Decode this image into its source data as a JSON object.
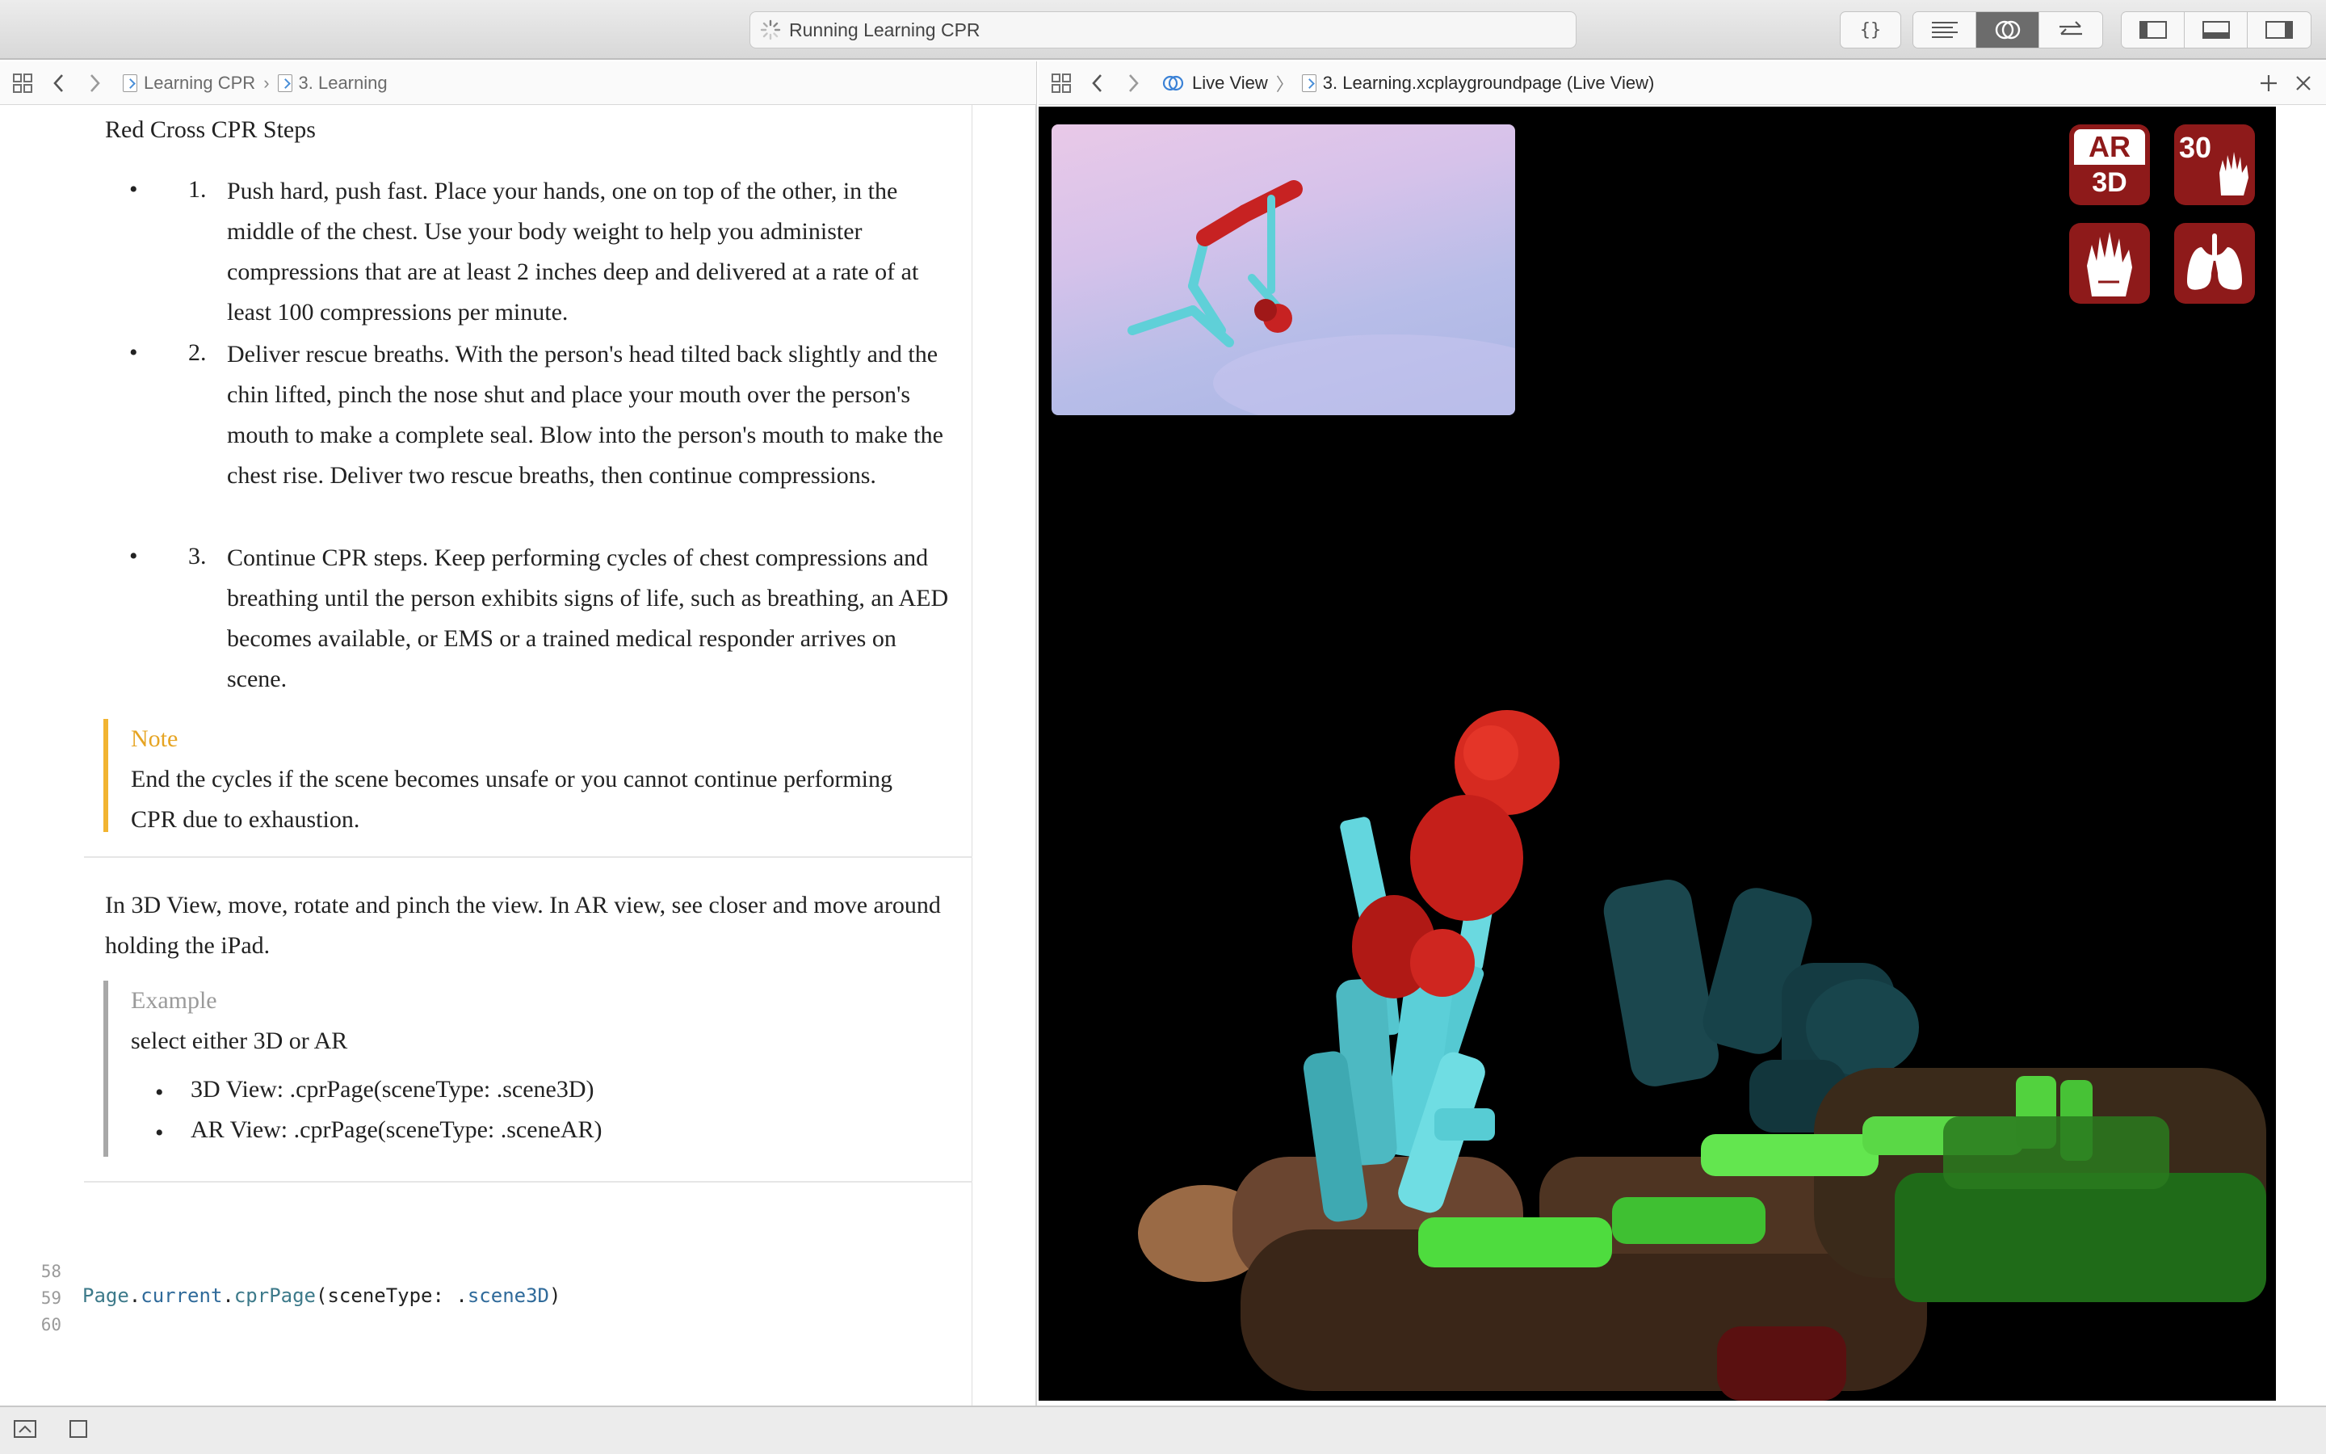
{
  "toolbar": {
    "activity_text": "Running Learning CPR"
  },
  "left_jumpbar": {
    "crumbs": [
      "Learning CPR",
      "3. Learning"
    ]
  },
  "right_jumpbar": {
    "crumbs": [
      "Live View",
      "3. Learning.xcplaygroundpage (Live View)"
    ]
  },
  "doc": {
    "heading": "Red Cross CPR Steps",
    "steps": [
      {
        "num": "1.",
        "text": "Push hard, push fast. Place your hands, one on top of the other, in the middle of the chest. Use your body weight to help you administer compressions that are at least 2 inches deep and delivered at a rate of at least 100 compressions per minute."
      },
      {
        "num": "2.",
        "text": "Deliver rescue breaths. With the person's head tilted back slightly and the chin lifted, pinch the nose shut and place your mouth over the person's mouth to make a complete seal. Blow into the person's mouth to make the chest rise. Deliver two rescue breaths, then continue compressions."
      },
      {
        "num": "3.",
        "text": "Continue CPR steps. Keep performing cycles of chest compressions and breathing until the person exhibits signs of life, such as breathing, an AED becomes available, or EMS or a trained medical responder arrives on scene."
      }
    ],
    "bullet": "•",
    "note_title": "Note",
    "note_text": "End the cycles if the scene becomes unsafe or you cannot continue performing CPR due to exhaustion.",
    "instructions": "In 3D View, move, rotate and pinch the view. In AR view, see closer and move around holding the iPad.",
    "example_title": "Example",
    "example_intro": "select either 3D or AR",
    "example_items": [
      "3D View: .cprPage(sceneType: .scene3D)",
      "AR View: .cprPage(sceneType: .sceneAR)"
    ]
  },
  "code": {
    "line_numbers": [
      "58",
      "59",
      "60"
    ],
    "tokens": {
      "t1": "Page",
      "t2": ".",
      "t3": "current",
      "t4": ".",
      "t5": "cprPage",
      "t6": "(sceneType: .",
      "t7": "scene3D",
      "t8": ")"
    }
  },
  "live_view": {
    "buttons": {
      "ar_top": "AR",
      "ar_bottom": "3D",
      "count": "30"
    },
    "colors": {
      "button_bg": "#8e1a1a",
      "rescuer": "#5ed3dc",
      "head": "#c8201c",
      "victim_skin": "#a0704a",
      "victim_shirt": "#3fcf35"
    }
  },
  "icons": [
    "grid-icon",
    "back-chevron-icon",
    "forward-chevron-icon",
    "swift-file-icon",
    "spinner-icon",
    "braces-icon",
    "standard-editor-icon",
    "assistant-editor-icon",
    "version-editor-icon",
    "navigator-toggle-icon",
    "debug-toggle-icon",
    "inspector-toggle-icon",
    "live-view-icon",
    "add-icon",
    "close-icon",
    "hands-icon",
    "lungs-icon",
    "console-toggle-icon",
    "stop-icon"
  ]
}
